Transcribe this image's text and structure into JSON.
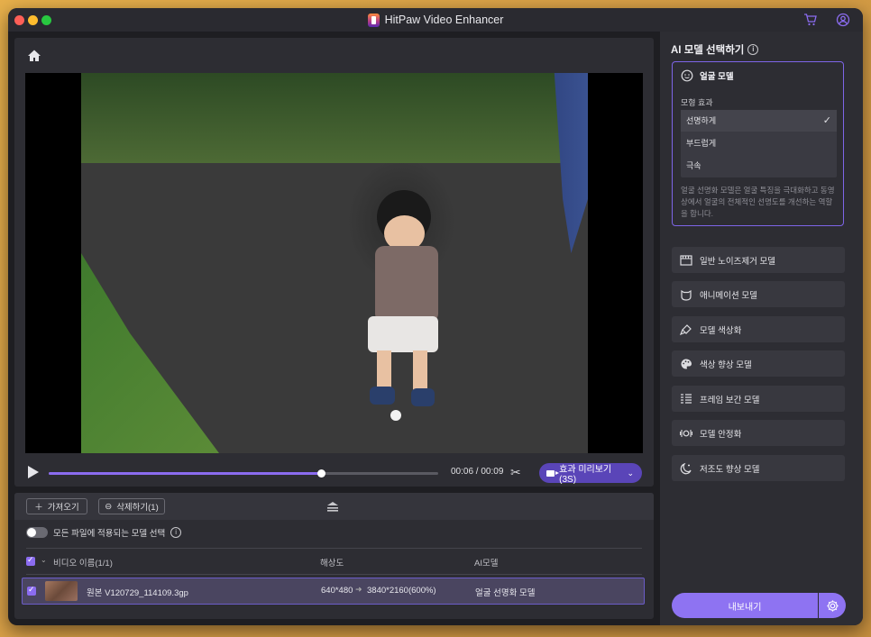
{
  "window": {
    "title": "HitPaw Video Enhancer"
  },
  "player": {
    "time": "00:06 / 00:09",
    "progress": 0.7,
    "preview_label": "효과 미리보기(3S)"
  },
  "file_panel": {
    "import_label": "가져오기",
    "delete_label": "삭제하기(1)",
    "apply_all_label": "모든 파일에 적용되는 모델 선택",
    "col_name": "비디오 이름(1/1)",
    "col_resolution": "해상도",
    "col_ai": "AI모델",
    "row": {
      "name": "원본 V120729_114109.3gp",
      "res_in": "640*480",
      "res_out": "3840*2160(600%)",
      "ai": "얼굴 선명화 모델"
    }
  },
  "sidebar": {
    "title": "AI 모델 선택하기",
    "active_model": {
      "name": "얼굴 모델",
      "effect_label": "모형 효과",
      "options": [
        "선명하게",
        "부드럽게",
        "극속"
      ],
      "selected": "선명하게",
      "description": "얼굴 선명화 모델은 얼굴 특징을 극대화하고 동영상에서 얼굴의 전체적인 선명도를 개선하는 역할을 합니다."
    },
    "models": [
      {
        "label": "일반 노이즈제거 모델",
        "icon": "film-icon"
      },
      {
        "label": "애니메이션 모델",
        "icon": "anime-icon"
      },
      {
        "label": "모델 색상화",
        "icon": "brush-icon"
      },
      {
        "label": "색상 향상 모델",
        "icon": "palette-icon"
      },
      {
        "label": "프레임 보간 모델",
        "icon": "frames-icon"
      },
      {
        "label": "모델 안정화",
        "icon": "stabilize-icon"
      },
      {
        "label": "저조도 향상 모델",
        "icon": "moon-icon"
      }
    ],
    "export_label": "내보내기"
  }
}
